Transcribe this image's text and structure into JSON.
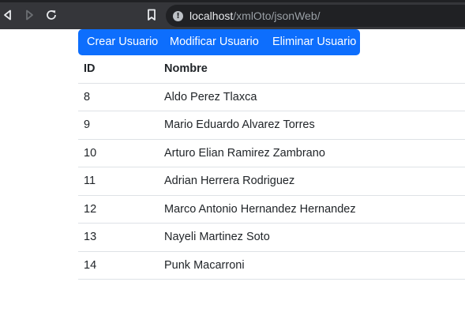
{
  "browser": {
    "url_host": "localhost",
    "url_path": "/xmlOto/jsonWeb/"
  },
  "actions": {
    "create_label": "Crear Usuario",
    "modify_label": "Modificar Usuario",
    "delete_label": "Eliminar Usuario"
  },
  "table": {
    "columns": [
      "ID",
      "Nombre"
    ],
    "rows": [
      {
        "id": "8",
        "nombre": "Aldo Perez Tlaxca"
      },
      {
        "id": "9",
        "nombre": "Mario Eduardo Alvarez Torres"
      },
      {
        "id": "10",
        "nombre": "Arturo Elian Ramirez Zambrano"
      },
      {
        "id": "11",
        "nombre": "Adrian Herrera Rodriguez"
      },
      {
        "id": "12",
        "nombre": "Marco Antonio Hernandez Hernandez"
      },
      {
        "id": "13",
        "nombre": "Nayeli Martinez Soto"
      },
      {
        "id": "14",
        "nombre": "Punk Macarroni"
      }
    ]
  },
  "colors": {
    "primary": "#0d6efd",
    "toolbar": "#35363a",
    "omnibox": "#202124"
  }
}
